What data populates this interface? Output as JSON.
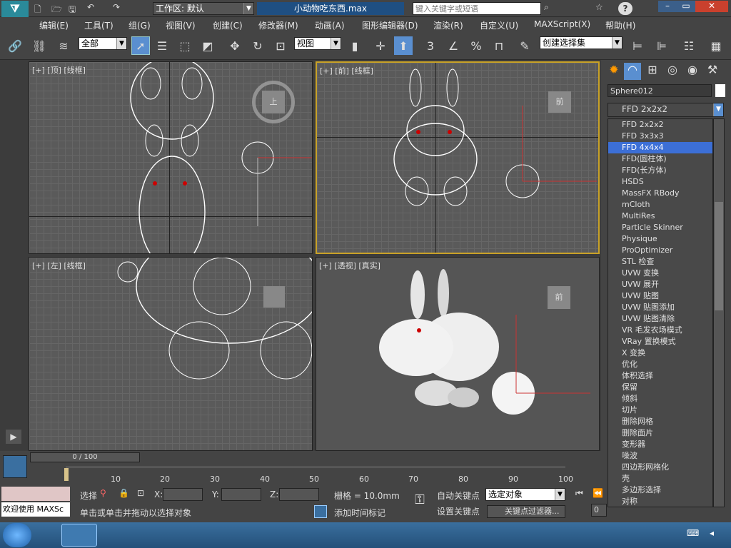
{
  "title": {
    "doc": "小动物吃东西.max",
    "workspace": "工作区: 默认",
    "search_placeholder": "键入关键字或短语"
  },
  "menu": [
    "编辑(E)",
    "工具(T)",
    "组(G)",
    "视图(V)",
    "创建(C)",
    "修改器(M)",
    "动画(A)",
    "图形编辑器(D)",
    "渲染(R)",
    "自定义(U)",
    "MAXScript(X)",
    "帮助(H)"
  ],
  "toolbar": {
    "filter": "全部",
    "coord": "视图",
    "named_sel": "创建选择集"
  },
  "viewports": {
    "top": "[+] [顶] [线框]",
    "front": "[+] [前] [线框]",
    "left": "[+] [左] [线框]",
    "persp": "[+] [透视] [真实]"
  },
  "viewcube": {
    "top": "上",
    "front": "前",
    "left": "",
    "persp": "前"
  },
  "panel": {
    "object_name": "Sphere012",
    "modifier_selected": "FFD 2x2x2",
    "modifiers": [
      "FFD 2x2x2",
      "FFD 3x3x3",
      "FFD 4x4x4",
      "FFD(圆柱体)",
      "FFD(长方体)",
      "HSDS",
      "MassFX RBody",
      "mCloth",
      "MultiRes",
      "Particle Skinner",
      "Physique",
      "ProOptimizer",
      "STL 检查",
      "UVW 变换",
      "UVW 展开",
      "UVW 贴图",
      "UVW 贴图添加",
      "UVW 贴图清除",
      "VR 毛发农场模式",
      "VRay 置换模式",
      "X 变换",
      "优化",
      "体积选择",
      "保留",
      "倾斜",
      "切片",
      "删除网格",
      "删除面片",
      "变形器",
      "噪波",
      "四边形网格化",
      "壳",
      "多边形选择",
      "对称"
    ],
    "highlight_index": 2
  },
  "timeline": {
    "frame": "0 / 100",
    "ticks": [
      "10",
      "20",
      "30",
      "40",
      "50",
      "60",
      "70",
      "80",
      "90",
      "100"
    ]
  },
  "status": {
    "welcome": "欢迎使用 MAXSc",
    "select": "选择",
    "x_label": "X:",
    "y_label": "Y:",
    "z_label": "Z:",
    "grid": "栅格 = 10.0mm",
    "prompt": "单击或单击并拖动以选择对象",
    "add_time_tag": "添加时间标记",
    "auto_key": "自动关键点",
    "set_key": "设置关键点",
    "selected_obj": "选定对象",
    "key_filter": "关键点过滤器...",
    "frame_field": "0"
  },
  "colors": {
    "accent": "#3c6fd6",
    "active_viewport": "#c9a227"
  }
}
